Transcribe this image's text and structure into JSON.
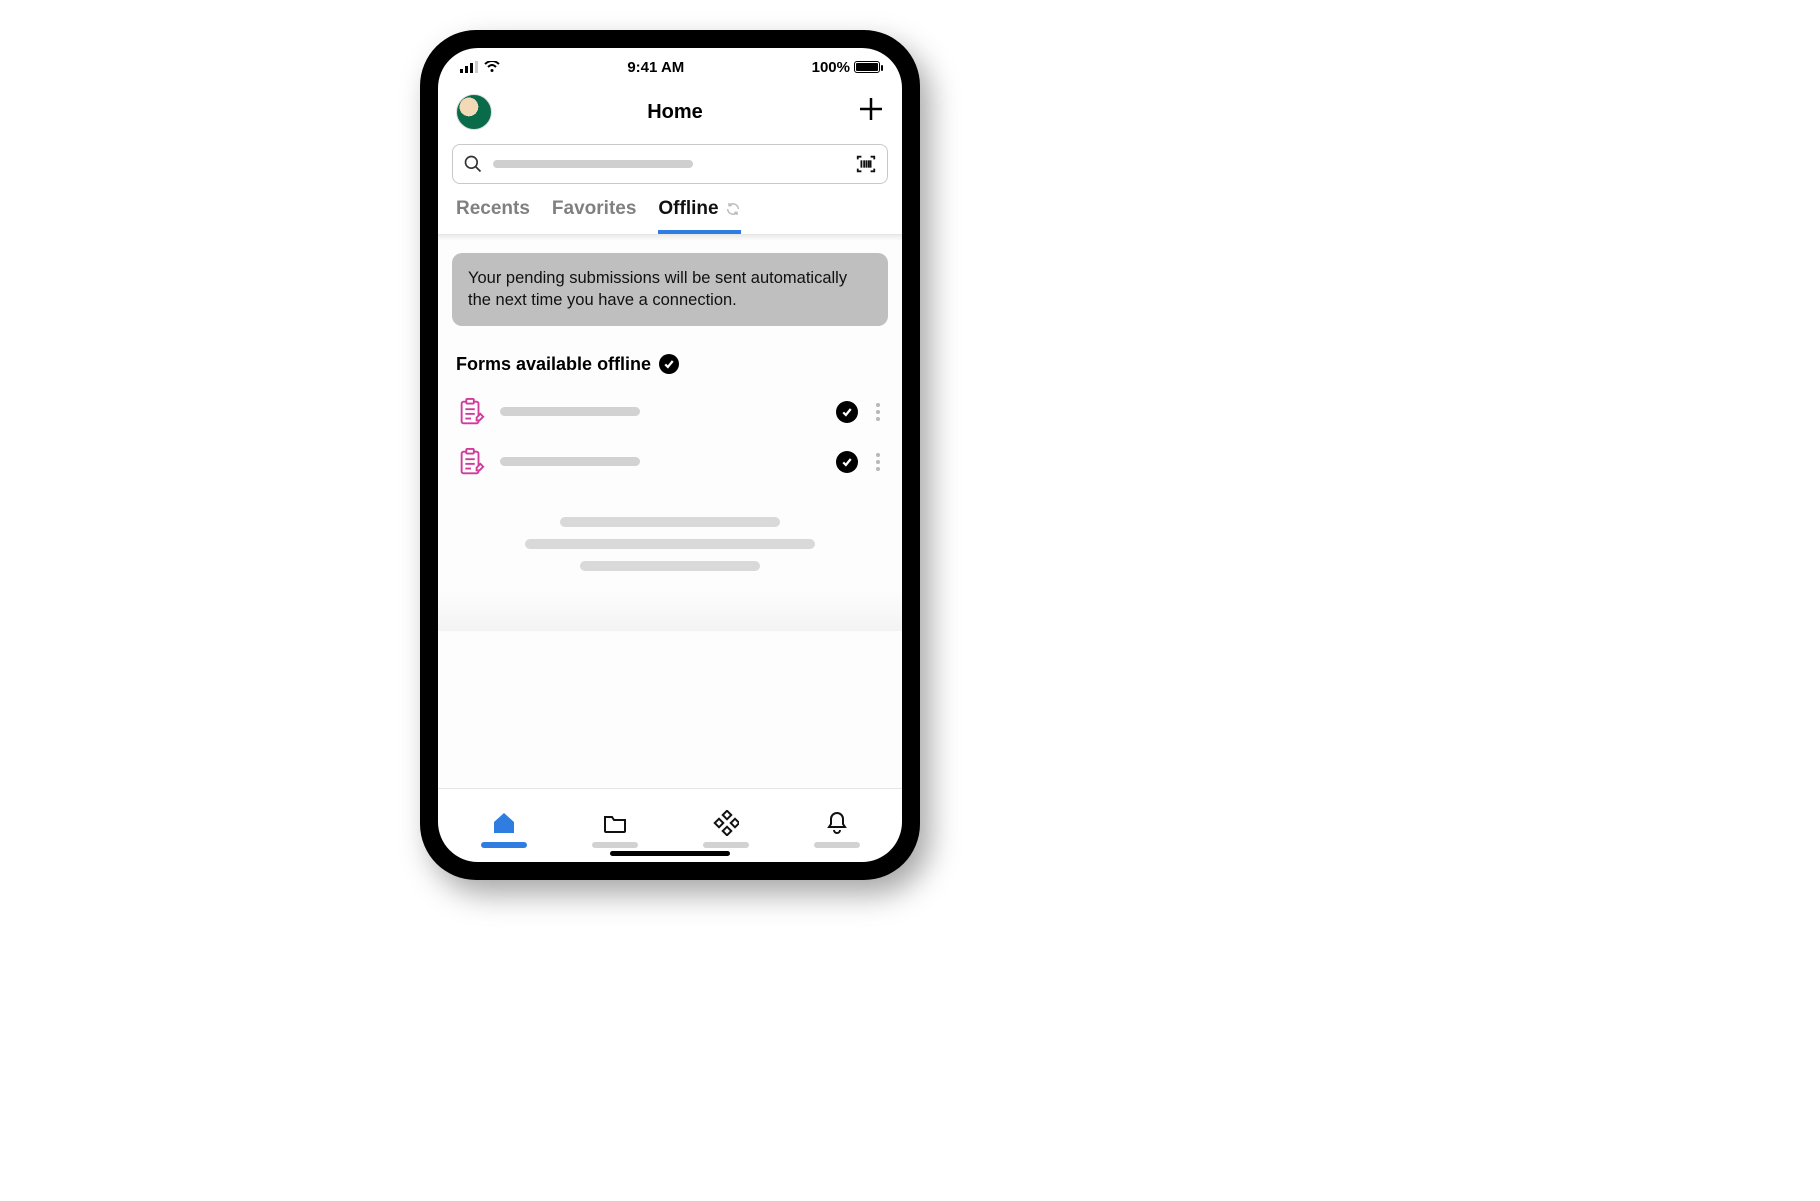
{
  "status": {
    "time": "9:41 AM",
    "battery": "100%"
  },
  "header": {
    "title": "Home"
  },
  "tabs": {
    "items": [
      {
        "label": "Recents"
      },
      {
        "label": "Favorites"
      },
      {
        "label": "Offline"
      }
    ],
    "active_index": 2
  },
  "info_banner": "Your pending submissions will be sent automatically the next time you have a connection.",
  "section": {
    "title": "Forms available offline"
  }
}
